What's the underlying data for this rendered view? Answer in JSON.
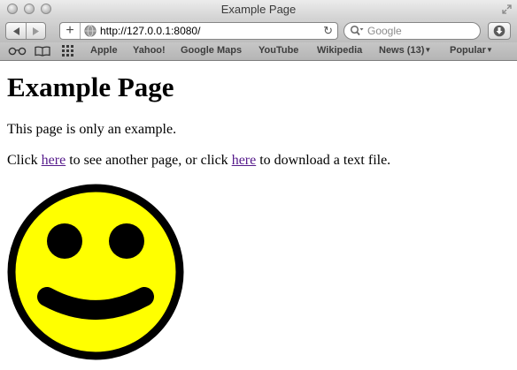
{
  "window": {
    "title": "Example Page"
  },
  "toolbar": {
    "url": "http://127.0.0.1:8080/",
    "search_placeholder": "Google"
  },
  "bookmarks": [
    {
      "label": "Apple"
    },
    {
      "label": "Yahoo!"
    },
    {
      "label": "Google Maps"
    },
    {
      "label": "YouTube"
    },
    {
      "label": "Wikipedia"
    },
    {
      "label": "News (13)"
    },
    {
      "label": "Popular"
    }
  ],
  "page": {
    "heading": "Example Page",
    "paragraph1": "This page is only an example.",
    "line2": {
      "prefix": "Click ",
      "link1": "here",
      "middle": " to see another page, or click ",
      "link2": "here",
      "suffix": " to download a text file."
    }
  },
  "colors": {
    "smiley_fill": "#ffff00",
    "smiley_outline": "#000000",
    "visited_link": "#551a8b"
  },
  "icons": [
    "back-icon",
    "forward-icon",
    "plus-icon",
    "globe-icon",
    "reload-icon",
    "search-icon",
    "download-icon",
    "reading-glasses-icon",
    "book-icon",
    "grid-icon",
    "resize-icon"
  ]
}
